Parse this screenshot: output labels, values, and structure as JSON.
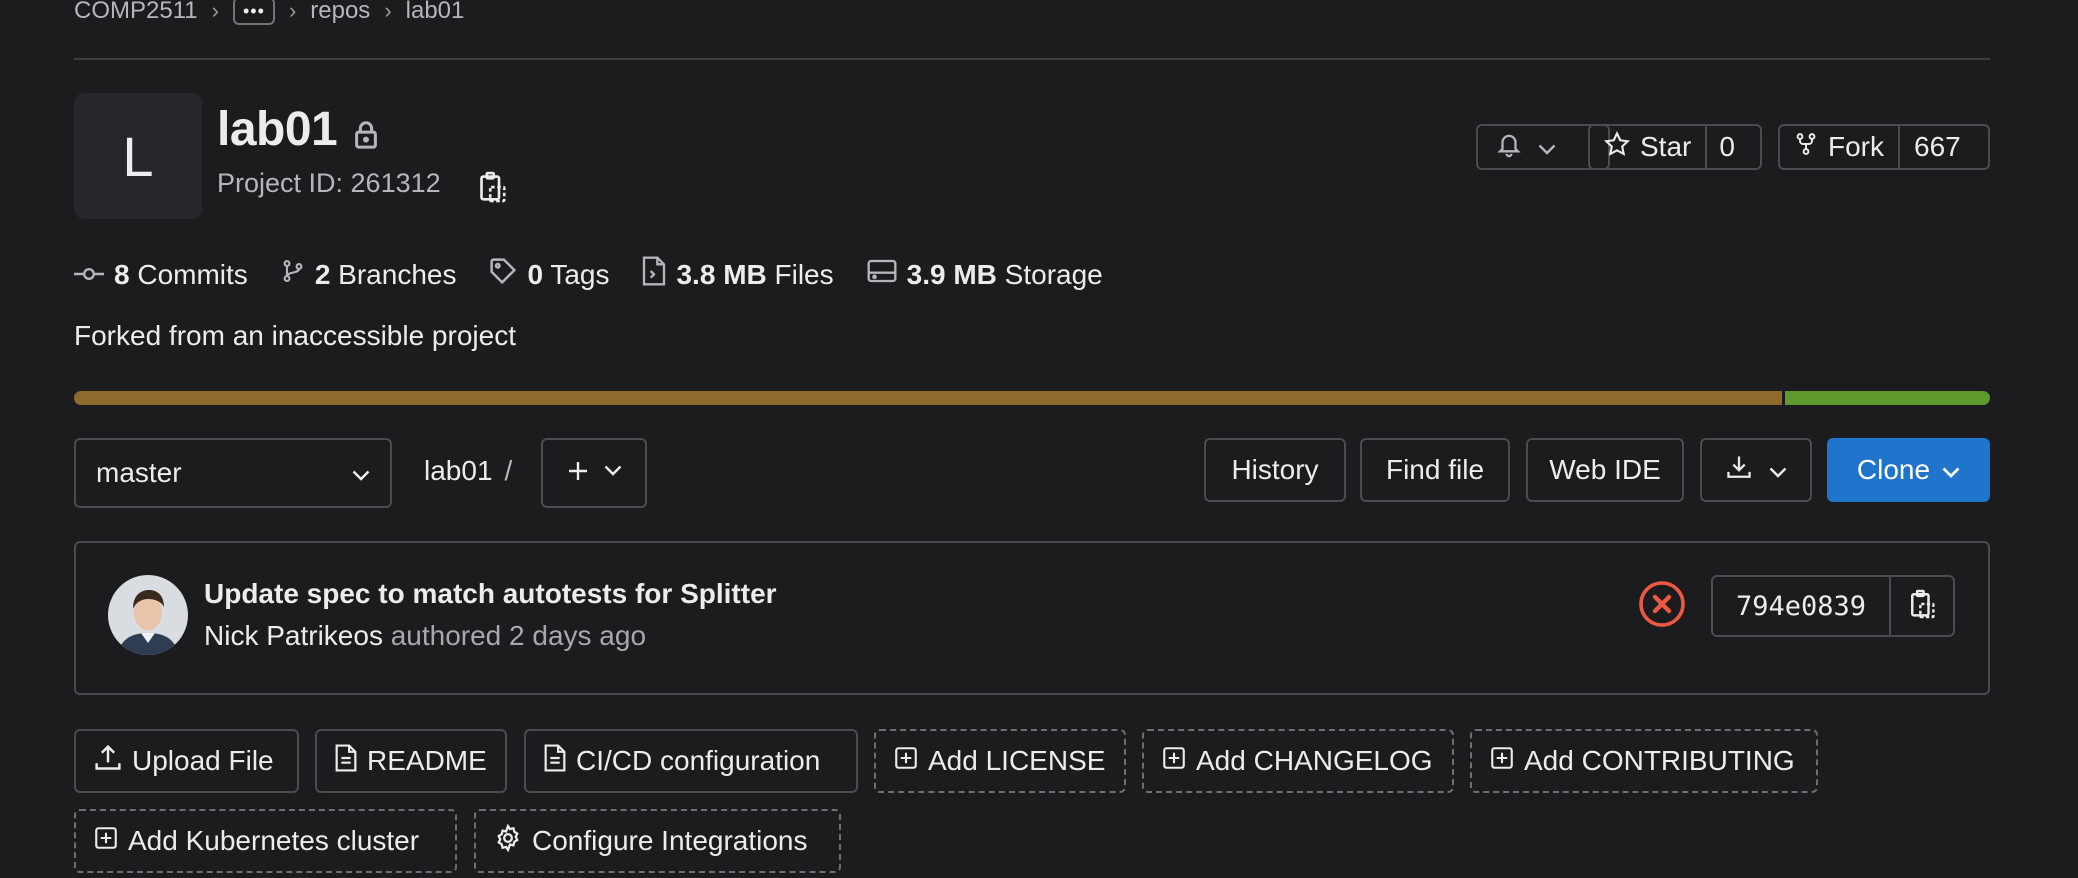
{
  "breadcrumb": {
    "items": [
      "COMP2511",
      "repos",
      "lab01"
    ],
    "more": "•••",
    "separator": "›"
  },
  "project": {
    "avatar_letter": "L",
    "name": "lab01",
    "id_label": "Project ID: 261312"
  },
  "header_actions": {
    "star_label": "Star",
    "star_count": "0",
    "fork_label": "Fork",
    "fork_count": "667"
  },
  "stats": {
    "commits_count": "8",
    "commits_label": "Commits",
    "branches_count": "2",
    "branches_label": "Branches",
    "tags_count": "0",
    "tags_label": "Tags",
    "files_size": "3.8 MB",
    "files_label": "Files",
    "storage_size": "3.9 MB",
    "storage_label": "Storage"
  },
  "forked_text": "Forked from an inaccessible project",
  "language_bar": {
    "segments": [
      {
        "fraction": 0.893,
        "color": "#8f6a2d"
      },
      {
        "fraction": 0.107,
        "color": "#5e9a2e"
      }
    ]
  },
  "toolbar": {
    "branch": "master",
    "path": "lab01",
    "path_sep": "/",
    "history": "History",
    "find_file": "Find file",
    "web_ide": "Web IDE",
    "clone": "Clone"
  },
  "commit": {
    "message": "Update spec to match autotests for Splitter",
    "author": "Nick Patrikeos",
    "authored": "authored 2 days ago",
    "sha": "794e0839",
    "status": "failed"
  },
  "quick_actions": {
    "upload": "Upload File",
    "readme": "README",
    "cicd": "CI/CD configuration",
    "add_license": "Add LICENSE",
    "add_changelog": "Add CHANGELOG",
    "add_contributing": "Add CONTRIBUTING",
    "add_k8s": "Add Kubernetes cluster",
    "configure_integrations": "Configure Integrations"
  },
  "colors": {
    "background": "#1c1c1e",
    "clone_button": "#1f75cb",
    "failed_status": "#ec5941"
  }
}
